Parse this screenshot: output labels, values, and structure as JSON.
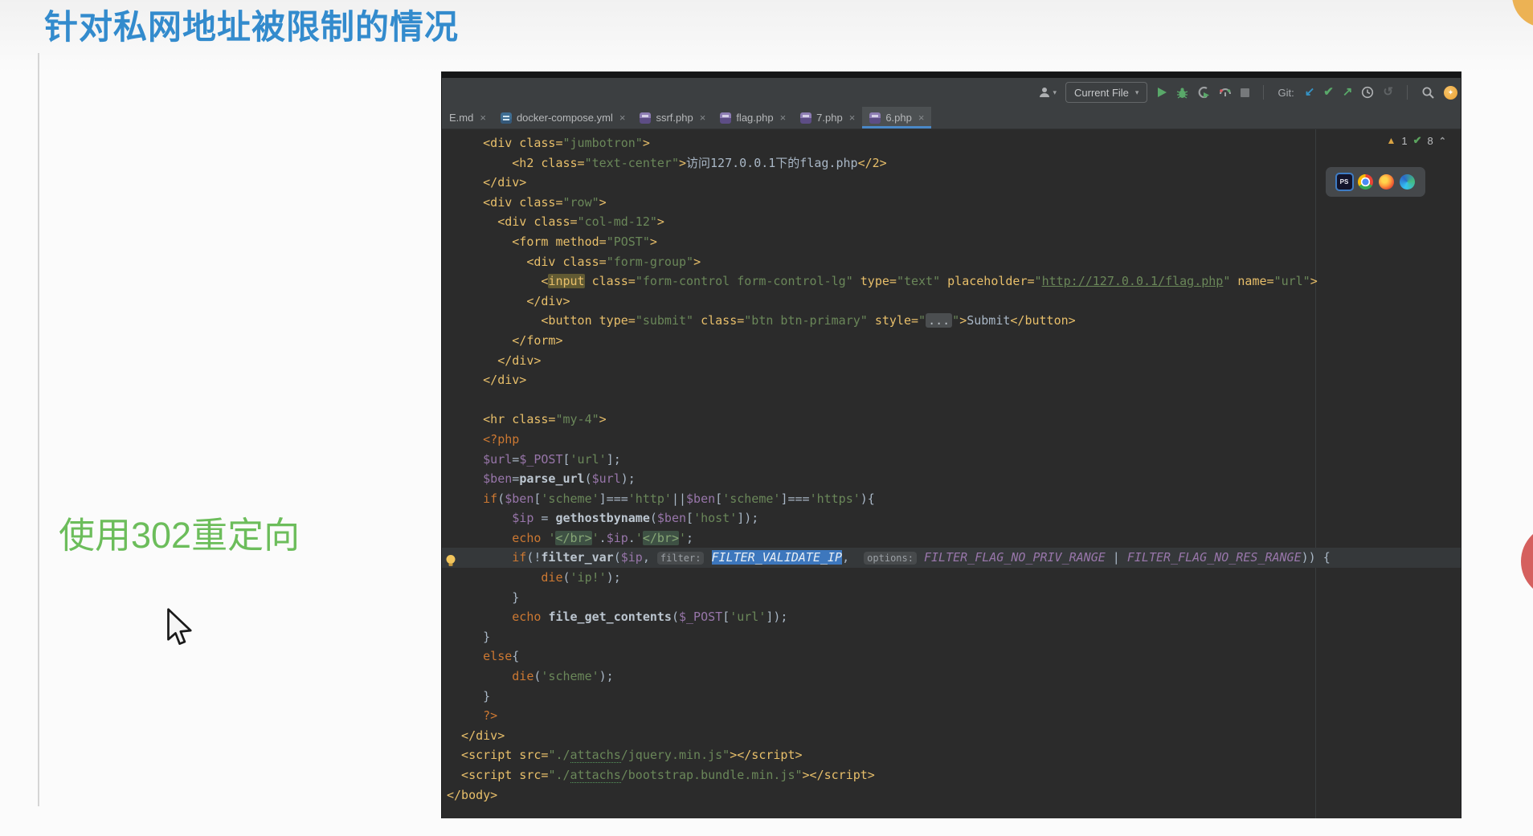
{
  "page": {
    "title": "针对私网地址被限制的情况",
    "note": "使用302重定向"
  },
  "colors": {
    "title_blue": "#338bcd",
    "note_green": "#6cbd5b",
    "tab_underline": "#4a88c7",
    "selection_blue": "#3d77bd",
    "editor_bg": "#2b2b2b",
    "toolbar_bg": "#3c3f41"
  },
  "icons": {
    "warning": "▲",
    "check": "✔",
    "chevron_up": "⌃",
    "close": "×",
    "caret_down": "▾",
    "update": "↙",
    "commit": "✔",
    "push": "↗",
    "rollback": "↺",
    "ps_logo": "PS"
  },
  "ide": {
    "toolbar": {
      "run_config": "Current File",
      "git_label": "Git:"
    },
    "tabs": [
      {
        "label": "E.md",
        "icon": "none",
        "active": false
      },
      {
        "label": "docker-compose.yml",
        "icon": "docker",
        "active": false
      },
      {
        "label": "ssrf.php",
        "icon": "php",
        "active": false
      },
      {
        "label": "flag.php",
        "icon": "php",
        "active": false
      },
      {
        "label": "7.php",
        "icon": "php",
        "active": false
      },
      {
        "label": "6.php",
        "icon": "php",
        "active": true
      }
    ],
    "inspections": {
      "warnings": "1",
      "typos": "8"
    },
    "browsers": [
      "phpstorm",
      "chrome",
      "firefox",
      "edge"
    ],
    "code": {
      "lines": [
        {
          "seg": [
            [
              "t",
              "     <div class="
            ],
            [
              "s",
              "\"jumbotron\""
            ],
            [
              "t",
              ">"
            ]
          ]
        },
        {
          "seg": [
            [
              "t",
              "         <h2 class="
            ],
            [
              "s",
              "\"text-center\""
            ],
            [
              "t",
              ">"
            ],
            [
              "p",
              "访问127.0.0.1下的flag.php"
            ],
            [
              "t",
              "</2>"
            ]
          ]
        },
        {
          "seg": [
            [
              "t",
              "     </div>"
            ]
          ]
        },
        {
          "seg": [
            [
              "t",
              "     <div class="
            ],
            [
              "s",
              "\"row\""
            ],
            [
              "t",
              ">"
            ]
          ]
        },
        {
          "seg": [
            [
              "t",
              "       <div class="
            ],
            [
              "s",
              "\"col-md-12\""
            ],
            [
              "t",
              ">"
            ]
          ]
        },
        {
          "seg": [
            [
              "t",
              "         <form method="
            ],
            [
              "s",
              "\"POST\""
            ],
            [
              "t",
              ">"
            ]
          ]
        },
        {
          "seg": [
            [
              "t",
              "           <div class="
            ],
            [
              "s",
              "\"form-group\""
            ],
            [
              "t",
              ">"
            ]
          ]
        },
        {
          "seg": [
            [
              "t",
              "             <"
            ],
            [
              "wh",
              "input"
            ],
            [
              "t",
              " class="
            ],
            [
              "s",
              "\"form-control form-control-lg\""
            ],
            [
              "t",
              " type="
            ],
            [
              "s",
              "\"text\""
            ],
            [
              "t",
              " placeholder="
            ],
            [
              "s",
              "\""
            ],
            [
              "su",
              "http://127.0.0.1/flag.php"
            ],
            [
              "s",
              "\""
            ],
            [
              "t",
              " name="
            ],
            [
              "s",
              "\"url\""
            ],
            [
              "t",
              ">"
            ]
          ]
        },
        {
          "seg": [
            [
              "t",
              "           </div>"
            ]
          ]
        },
        {
          "seg": [
            [
              "t",
              "             <button type="
            ],
            [
              "s",
              "\"submit\""
            ],
            [
              "t",
              " class="
            ],
            [
              "s",
              "\"btn btn-primary\""
            ],
            [
              "t",
              " style="
            ],
            [
              "s",
              "\""
            ],
            [
              "fold",
              "..."
            ],
            [
              "s",
              "\""
            ],
            [
              "t",
              ">"
            ],
            [
              "p",
              "Submit"
            ],
            [
              "t",
              "</button>"
            ]
          ]
        },
        {
          "seg": [
            [
              "t",
              "         </form>"
            ]
          ]
        },
        {
          "seg": [
            [
              "t",
              "       </div>"
            ]
          ]
        },
        {
          "seg": [
            [
              "t",
              "     </div>"
            ]
          ]
        },
        {
          "seg": [
            [
              "p",
              ""
            ]
          ]
        },
        {
          "seg": [
            [
              "t",
              "     <hr class="
            ],
            [
              "s",
              "\"my-4\""
            ],
            [
              "t",
              ">"
            ]
          ]
        },
        {
          "seg": [
            [
              "k",
              "     <?php"
            ]
          ]
        },
        {
          "seg": [
            [
              "v",
              "     $url"
            ],
            [
              "p",
              "="
            ],
            [
              "v",
              "$_POST"
            ],
            [
              "p",
              "["
            ],
            [
              "s",
              "'url'"
            ],
            [
              "p",
              "];"
            ]
          ]
        },
        {
          "seg": [
            [
              "v",
              "     $ben"
            ],
            [
              "p",
              "="
            ],
            [
              "f",
              "parse_url"
            ],
            [
              "p",
              "("
            ],
            [
              "v",
              "$url"
            ],
            [
              "p",
              ");"
            ]
          ]
        },
        {
          "seg": [
            [
              "k",
              "     if"
            ],
            [
              "p",
              "("
            ],
            [
              "v",
              "$ben"
            ],
            [
              "p",
              "["
            ],
            [
              "s",
              "'scheme'"
            ],
            [
              "p",
              "]==="
            ],
            [
              "s",
              "'http'"
            ],
            [
              "p",
              "||"
            ],
            [
              "v",
              "$ben"
            ],
            [
              "p",
              "["
            ],
            [
              "s",
              "'scheme'"
            ],
            [
              "p",
              "]==="
            ],
            [
              "s",
              "'https'"
            ],
            [
              "p",
              "){"
            ]
          ]
        },
        {
          "seg": [
            [
              "v",
              "         $ip"
            ],
            [
              "p",
              " = "
            ],
            [
              "f",
              "gethostbyname"
            ],
            [
              "p",
              "("
            ],
            [
              "v",
              "$ben"
            ],
            [
              "p",
              "["
            ],
            [
              "s",
              "'host'"
            ],
            [
              "p",
              "]);"
            ]
          ]
        },
        {
          "seg": [
            [
              "k",
              "         echo"
            ],
            [
              "p",
              " "
            ],
            [
              "s",
              "'"
            ],
            [
              "tm",
              "</br>"
            ],
            [
              "s",
              "'"
            ],
            [
              "p",
              "."
            ],
            [
              "v",
              "$ip"
            ],
            [
              "p",
              "."
            ],
            [
              "s",
              "'"
            ],
            [
              "tm",
              "</br>"
            ],
            [
              "s",
              "'"
            ],
            [
              "p",
              ";"
            ]
          ]
        },
        {
          "hl": true,
          "seg": [
            [
              "k",
              "         if"
            ],
            [
              "p",
              "(!"
            ],
            [
              "f",
              "filter_var"
            ],
            [
              "p",
              "("
            ],
            [
              "v",
              "$ip"
            ],
            [
              "p",
              ", "
            ],
            [
              "h",
              "filter:"
            ],
            [
              "p",
              " "
            ],
            [
              "cs",
              "FILTER_VALIDATE_IP"
            ],
            [
              "p",
              ",  "
            ],
            [
              "h",
              "options:"
            ],
            [
              "p",
              " "
            ],
            [
              "c",
              "FILTER_FLAG_NO_PRIV_RANGE"
            ],
            [
              "p",
              " | "
            ],
            [
              "c",
              "FILTER_FLAG_NO_RES_RANGE"
            ],
            [
              "p",
              ")) {"
            ]
          ]
        },
        {
          "seg": [
            [
              "k",
              "             die"
            ],
            [
              "p",
              "("
            ],
            [
              "s",
              "'ip!'"
            ],
            [
              "p",
              ");"
            ]
          ]
        },
        {
          "seg": [
            [
              "p",
              "         }"
            ]
          ]
        },
        {
          "seg": [
            [
              "k",
              "         echo"
            ],
            [
              "p",
              " "
            ],
            [
              "f",
              "file_get_contents"
            ],
            [
              "p",
              "("
            ],
            [
              "v",
              "$_POST"
            ],
            [
              "p",
              "["
            ],
            [
              "s",
              "'url'"
            ],
            [
              "p",
              "]);"
            ]
          ]
        },
        {
          "seg": [
            [
              "p",
              "     }"
            ]
          ]
        },
        {
          "seg": [
            [
              "k",
              "     else"
            ],
            [
              "p",
              "{"
            ]
          ]
        },
        {
          "seg": [
            [
              "k",
              "         die"
            ],
            [
              "p",
              "("
            ],
            [
              "s",
              "'scheme'"
            ],
            [
              "p",
              ");"
            ]
          ]
        },
        {
          "seg": [
            [
              "p",
              "     }"
            ]
          ]
        },
        {
          "seg": [
            [
              "k",
              "     ?>"
            ]
          ]
        },
        {
          "seg": [
            [
              "t",
              "  </div>"
            ]
          ]
        },
        {
          "seg": [
            [
              "t",
              "  <script src="
            ],
            [
              "s",
              "\"./"
            ],
            [
              "sq",
              "attachs"
            ],
            [
              "s",
              "/jquery.min.js\""
            ],
            [
              "t",
              "></script>"
            ]
          ]
        },
        {
          "seg": [
            [
              "t",
              "  <script src="
            ],
            [
              "s",
              "\"./"
            ],
            [
              "sq",
              "attachs"
            ],
            [
              "s",
              "/bootstrap.bundle.min.js\""
            ],
            [
              "t",
              "></script>"
            ]
          ]
        },
        {
          "seg": [
            [
              "t",
              "</body>"
            ]
          ]
        }
      ]
    }
  }
}
